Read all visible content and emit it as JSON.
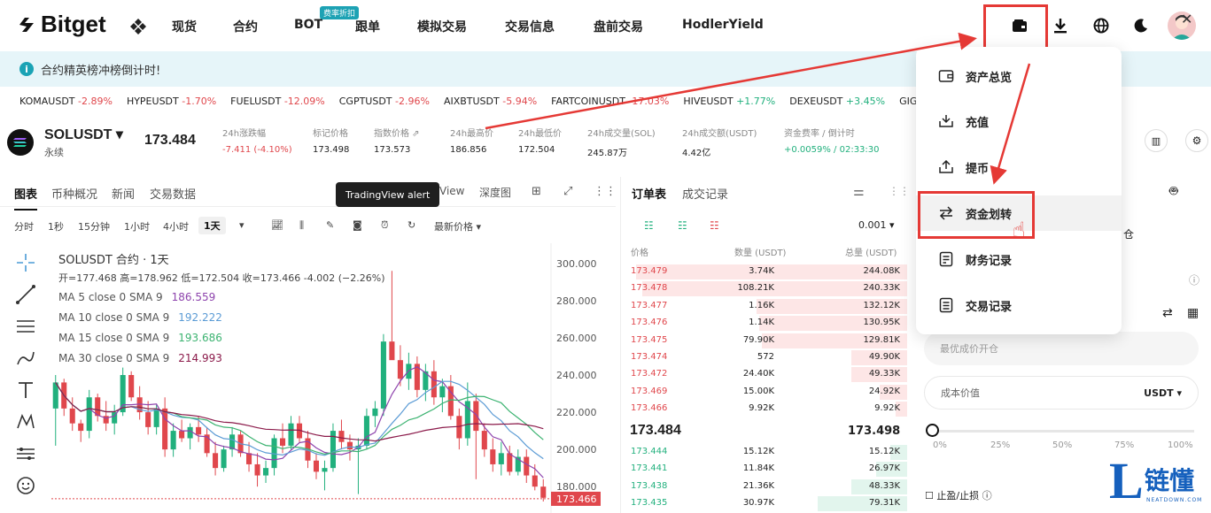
{
  "nav": {
    "logo": "Bitget",
    "items": [
      "现货",
      "合约",
      "BOT",
      "跟单",
      "模拟交易",
      "交易信息",
      "盘前交易",
      "HodlerYield"
    ],
    "bot_badge": "费率折扣"
  },
  "notice": {
    "text": "合约精英榜冲榜倒计时!"
  },
  "ticker": [
    {
      "sym": "KOMAUSDT",
      "chg": "-2.89%",
      "dir": "dn"
    },
    {
      "sym": "HYPEUSDT",
      "chg": "-1.70%",
      "dir": "dn"
    },
    {
      "sym": "FUELUSDT",
      "chg": "-12.09%",
      "dir": "dn"
    },
    {
      "sym": "CGPTUSDT",
      "chg": "-2.96%",
      "dir": "dn"
    },
    {
      "sym": "AIXBTUSDT",
      "chg": "-5.94%",
      "dir": "dn"
    },
    {
      "sym": "FARTCOINUSDT",
      "chg": "-17.03%",
      "dir": "dn"
    },
    {
      "sym": "HIVEUSDT",
      "chg": "+1.77%",
      "dir": "up"
    },
    {
      "sym": "DEXEUSDT",
      "chg": "+3.45%",
      "dir": "up"
    },
    {
      "sym": "GIGA",
      "chg": "",
      "dir": "up"
    }
  ],
  "symbol": {
    "name": "SOLUSDT",
    "sub": "永续",
    "price": "173.484",
    "stats": [
      {
        "label": "24h涨跌幅",
        "value": "-7.411 (-4.10%)",
        "dir": "dn"
      },
      {
        "label": "标记价格",
        "value": "173.498",
        "dir": ""
      },
      {
        "label": "指数价格",
        "value": "173.573",
        "dir": ""
      },
      {
        "label": "24h最高价",
        "value": "186.856",
        "dir": ""
      },
      {
        "label": "24h最低价",
        "value": "172.504",
        "dir": ""
      },
      {
        "label": "24h成交量(SOL)",
        "value": "245.87万",
        "dir": ""
      },
      {
        "label": "24h成交额(USDT)",
        "value": "4.42亿",
        "dir": ""
      },
      {
        "label": "资金费率 / 倒计时",
        "value": "+0.0059% / 02:33:30",
        "dir": "up"
      }
    ]
  },
  "chart_panel": {
    "tabs": [
      "图表",
      "币种概况",
      "新闻",
      "交易数据"
    ],
    "view_tabs": [
      "View",
      "深度图"
    ],
    "tooltip": "TradingView alert",
    "intervals": [
      "分时",
      "1秒",
      "15分钟",
      "1小时",
      "4小时",
      "1天"
    ],
    "price_type": "最新价格",
    "title": "SOLUSDT 合约 · 1天",
    "ohlc": "开=177.468 高=178.962 低=172.504 收=173.466 -4.002 (−2.26%)",
    "ma": [
      {
        "label": "MA 5 close 0 SMA 9",
        "value": "186.559",
        "color": "#8e44ad"
      },
      {
        "label": "MA 10 close 0 SMA 9",
        "value": "192.222",
        "color": "#5b9bd5"
      },
      {
        "label": "MA 15 close 0 SMA 9",
        "value": "193.686",
        "color": "#3cb371"
      },
      {
        "label": "MA 30 close 0 SMA 9",
        "value": "214.993",
        "color": "#8b1a4a"
      }
    ],
    "last_price_tag": "173.466"
  },
  "chart_data": {
    "type": "candlestick",
    "y_ticks": [
      300,
      280,
      260,
      240,
      220,
      200,
      180
    ],
    "ylim": [
      172,
      308
    ],
    "candles": [
      [
        222,
        240,
        202,
        236
      ],
      [
        236,
        238,
        218,
        222
      ],
      [
        222,
        228,
        210,
        214
      ],
      [
        214,
        216,
        204,
        210
      ],
      [
        210,
        232,
        206,
        228
      ],
      [
        228,
        230,
        215,
        218
      ],
      [
        218,
        226,
        210,
        214
      ],
      [
        214,
        224,
        208,
        220
      ],
      [
        220,
        244,
        218,
        240
      ],
      [
        240,
        242,
        226,
        228
      ],
      [
        228,
        234,
        216,
        220
      ],
      [
        220,
        226,
        208,
        212
      ],
      [
        212,
        224,
        208,
        222
      ],
      [
        222,
        228,
        196,
        200
      ],
      [
        200,
        214,
        196,
        210
      ],
      [
        210,
        216,
        204,
        206
      ],
      [
        206,
        214,
        200,
        212
      ],
      [
        212,
        218,
        204,
        208
      ],
      [
        208,
        212,
        196,
        198
      ],
      [
        198,
        204,
        186,
        190
      ],
      [
        190,
        202,
        188,
        200
      ],
      [
        200,
        212,
        196,
        208
      ],
      [
        208,
        210,
        196,
        198
      ],
      [
        198,
        204,
        188,
        192
      ],
      [
        192,
        198,
        180,
        186
      ],
      [
        186,
        194,
        182,
        190
      ],
      [
        190,
        208,
        186,
        206
      ],
      [
        206,
        214,
        198,
        202
      ],
      [
        202,
        218,
        200,
        214
      ],
      [
        214,
        218,
        204,
        206
      ],
      [
        206,
        210,
        190,
        194
      ],
      [
        194,
        198,
        184,
        188
      ],
      [
        188,
        194,
        178,
        190
      ],
      [
        190,
        214,
        188,
        210
      ],
      [
        210,
        216,
        200,
        204
      ],
      [
        204,
        208,
        194,
        200
      ],
      [
        200,
        206,
        176,
        202
      ],
      [
        202,
        222,
        200,
        218
      ],
      [
        218,
        226,
        212,
        222
      ],
      [
        222,
        262,
        218,
        258
      ],
      [
        258,
        296,
        252,
        248
      ],
      [
        248,
        256,
        234,
        238
      ],
      [
        238,
        252,
        232,
        246
      ],
      [
        246,
        250,
        228,
        232
      ],
      [
        232,
        246,
        226,
        242
      ],
      [
        242,
        248,
        224,
        228
      ],
      [
        228,
        238,
        220,
        234
      ],
      [
        234,
        240,
        216,
        218
      ],
      [
        218,
        222,
        200,
        206
      ],
      [
        206,
        236,
        202,
        226
      ],
      [
        226,
        230,
        184,
        210
      ],
      [
        210,
        214,
        196,
        200
      ],
      [
        200,
        206,
        188,
        192
      ],
      [
        192,
        204,
        186,
        198
      ],
      [
        198,
        202,
        186,
        188
      ],
      [
        188,
        200,
        186,
        196
      ],
      [
        196,
        200,
        182,
        186
      ],
      [
        186,
        192,
        178,
        180
      ],
      [
        180,
        184,
        172,
        174
      ]
    ]
  },
  "order_book": {
    "tabs": [
      "订单表",
      "成交记录"
    ],
    "tick": "0.001",
    "headers": [
      "价格",
      "数量 (USDT)",
      "总量 (USDT)"
    ],
    "asks": [
      {
        "p": "173.479",
        "q": "3.74K",
        "t": "244.08K",
        "d": 0.97
      },
      {
        "p": "173.478",
        "q": "108.21K",
        "t": "240.33K",
        "d": 0.95
      },
      {
        "p": "173.477",
        "q": "1.16K",
        "t": "132.12K",
        "d": 0.54
      },
      {
        "p": "173.476",
        "q": "1.14K",
        "t": "130.95K",
        "d": 0.53
      },
      {
        "p": "173.475",
        "q": "79.90K",
        "t": "129.81K",
        "d": 0.52
      },
      {
        "p": "173.474",
        "q": "572",
        "t": "49.90K",
        "d": 0.2
      },
      {
        "p": "173.472",
        "q": "24.40K",
        "t": "49.33K",
        "d": 0.2
      },
      {
        "p": "173.469",
        "q": "15.00K",
        "t": "24.92K",
        "d": 0.1
      },
      {
        "p": "173.466",
        "q": "9.92K",
        "t": "9.92K",
        "d": 0.04
      }
    ],
    "mid": "173.484",
    "mark": "173.498",
    "bids": [
      {
        "p": "173.444",
        "q": "15.12K",
        "t": "15.12K",
        "d": 0.06
      },
      {
        "p": "173.441",
        "q": "11.84K",
        "t": "26.97K",
        "d": 0.11
      },
      {
        "p": "173.438",
        "q": "21.36K",
        "t": "48.33K",
        "d": 0.2
      },
      {
        "p": "173.435",
        "q": "30.97K",
        "t": "79.31K",
        "d": 0.32
      }
    ]
  },
  "order_form": {
    "input1_placeholder": "最优成价开仓",
    "input2_label": "成本价值",
    "input2_unit": "USDT ▾",
    "slider_marks": [
      "0%",
      "25%",
      "50%",
      "75%",
      "100%"
    ],
    "tpsl": "止盈/止损",
    "partial_text": "仓"
  },
  "wallet_menu": {
    "items": [
      "资产总览",
      "充值",
      "提币",
      "资金划转",
      "财务记录",
      "交易记录"
    ],
    "highlighted": "资金划转"
  },
  "watermark": {
    "text": "链懂",
    "sub": "NEATDOWN.COM"
  },
  "colors": {
    "up": "#21b07d",
    "down": "#e0474c",
    "annotation": "#e53935",
    "accent": "#1aa3b5"
  }
}
